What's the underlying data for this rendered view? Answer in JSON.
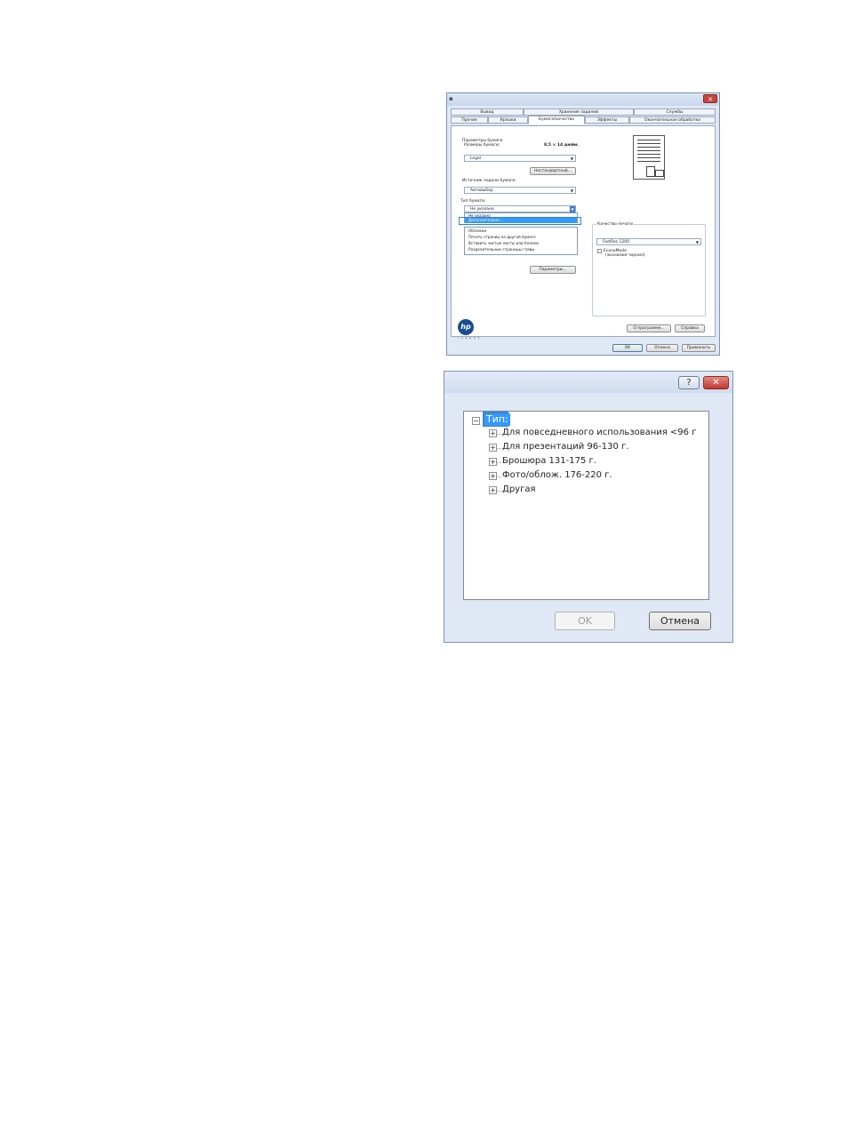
{
  "dialog1": {
    "tabs_top": [
      "Вывод",
      "Хранение заданий",
      "Службы"
    ],
    "tabs_bottom": [
      "Прочие",
      "Ярлыки",
      "Бумага/качество",
      "Эффекты",
      "Окончательная обработка"
    ],
    "paper_options_label": "Параметры бумаги",
    "paper_sizes_label": "Размеры бумаги:",
    "paper_size_value": "8,5 × 14 дюйм.",
    "paper_size_select": "Legal",
    "custom_button": "Нестандартный...",
    "source_label": "Источник подачи бумаги:",
    "source_select": "Автовыбор",
    "type_label": "Тип бумаги:",
    "type_select": "Не указано",
    "dropdown_items": [
      "Не указано",
      "Дополнительно..."
    ],
    "special_pages_items": [
      "Обложки",
      "Печать страниц на другой бумаге",
      "Вставить чистые листы или бланки",
      "Разделительные страницы главы"
    ],
    "params_button": "Параметры...",
    "print_quality_label": "Качество печати",
    "print_quality_select": "FastRes 1200",
    "economode_label": "EconoMode",
    "economode_sub": "(экономия чернил)",
    "about_button": "О программе...",
    "help_button": "Справка",
    "ok_button": "OK",
    "cancel_button": "Отмена",
    "apply_button": "Применить"
  },
  "dialog2": {
    "help_glyph": "?",
    "close_glyph": "✕",
    "root_label": "Тип:",
    "tree_items": [
      "Для повседневного использования <96 г",
      "Для презентаций 96-130 г.",
      "Брошюра 131-175 г.",
      "Фото/облож. 176-220 г.",
      "Другая"
    ],
    "ok_button": "OK",
    "cancel_button": "Отмена"
  },
  "colors": {
    "selection": "#3399ff",
    "callout": "#2f83c8",
    "close_red": "#c1392f"
  }
}
